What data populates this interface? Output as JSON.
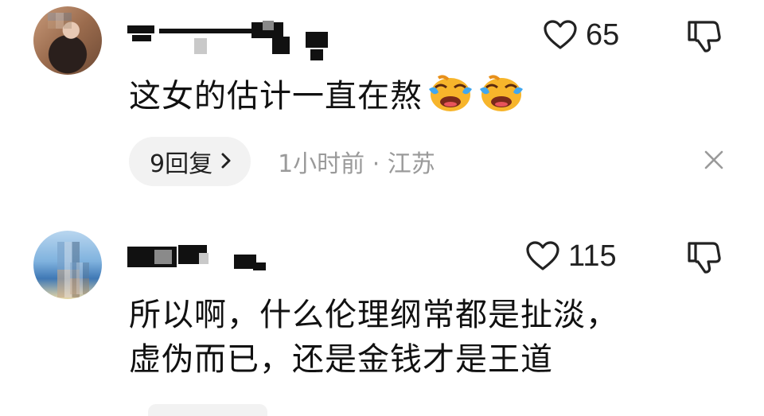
{
  "comments": [
    {
      "avatar_icon": "avatar",
      "like_count": "65",
      "text": "这女的估计一直在熬",
      "emoji_icon": "laughing-crying-emoji",
      "emoji_count": 2,
      "reply_label": "9回复",
      "reply_chevron": "›",
      "time_location": "1小时前 · 江苏"
    },
    {
      "avatar_icon": "avatar",
      "like_count": "115",
      "text_line1": "所以啊，什么伦理纲常都是扯淡，",
      "text_line2": "虚伪而已，还是金钱才是王道"
    }
  ],
  "colors": {
    "text": "#111111",
    "meta_text": "#9a9a9a",
    "chip_bg": "#f2f2f2",
    "icon_stroke": "#222222",
    "emoji_yellow": "#f7b52b",
    "emoji_tear": "#3fa7f0"
  }
}
